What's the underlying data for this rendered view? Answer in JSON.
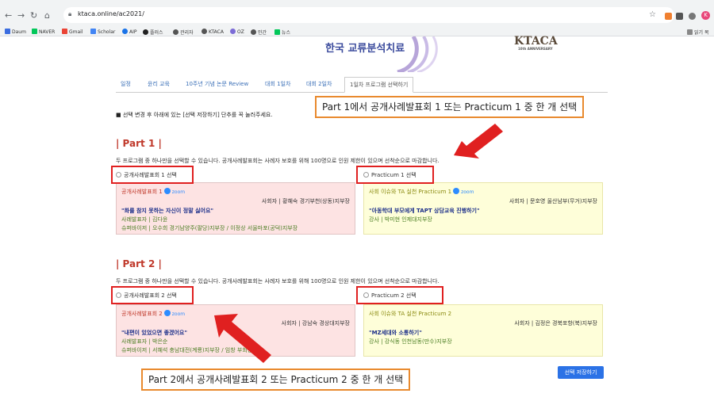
{
  "browser": {
    "url": "ktaca.online/ac2021/",
    "bookmarks": [
      "Daum",
      "NAVER",
      "Gmail",
      "Scholar",
      "AIP",
      "플러스",
      "관리자",
      "KTACA",
      "OZ",
      "민간",
      "뉴스"
    ],
    "reading_list": "읽기 목"
  },
  "banner": {
    "title": "한국 교류분석치료",
    "logo": "KTACA",
    "logo_sub": "10th ANNIVERSARY"
  },
  "tabs": [
    "일정",
    "윤리 교육",
    "10주년 기념 논문 Review",
    "대회 1일차",
    "대회 2일차",
    "1일차 프로그램 선택하기"
  ],
  "notice": "■ 선택 변경 후 아래에 있는 [선택 저장하기] 단추를 꼭 눌러주세요.",
  "part1": {
    "title": "| Part 1 |",
    "desc": "두 프로그램 중 하나만을 선택할 수 있습니다. 공개사례발표회는 사례자 보호를 위해 100명으로 인원 제한이 있으며 선착순으로 마감합니다.",
    "option_a": "공개사례발표회 1 선택",
    "option_b": "Practicum 1 선택",
    "a_title": "공개사례발표회 1",
    "a_moderator": "사회자 | 황혜숙 경기부천(상동)지부장",
    "a_topic": "\"화를 참지 못하는 자신이 정말 싫어요\"",
    "a_presenter": "사례발표자 | 김다윤",
    "a_supervisor": "슈퍼바이저 | 오수희 경기남양주(팔당)지부장 / 이정상 서울마포(공덕)지부장",
    "b_title": "사회 이슈와 TA 실천 Practicum 1",
    "b_moderator": "사회자 | 문호영 울산남부(무거)지부장",
    "b_topic": "\"아동학대 부모에게 TAPT 상담교육 진행하기\"",
    "b_lecturer": "강사 | 박미현 인제대지부장"
  },
  "part2": {
    "title": "| Part 2 |",
    "desc": "두 프로그램 중 하나만을 선택할 수 있습니다. 공개사례발표회는 사례자 보호를 위해 100명으로 인원 제한이 있으며 선착순으로 마감합니다.",
    "option_a": "공개사례발표회 2 선택",
    "option_b": "Practicum 2 선택",
    "a_title": "공개사례발표회 2",
    "a_moderator": "사회자 | 강남숙 경상대지부장",
    "a_topic": "\"내편이 있었으면 좋겠어요\"",
    "a_presenter": "사례발표자 | 박은순",
    "a_supervisor": "슈퍼바이저 | 서혜석 충남대전(계룡)지부장 / 임창 부회장",
    "b_title": "사회 이슈와 TA 실천 Practicum 2",
    "b_moderator": "사회자 | 김정은 경북포항(북)지부장",
    "b_topic": "\"MZ세대와 소통하기\"",
    "b_lecturer": "강사 | 강식동 인천남동(만수)지부장"
  },
  "zoom_label": "zoom",
  "callout1": "Part 1에서 공개사례발표회 1 또는 Practicum 1 중 한 개 선택",
  "callout2": "Part 2에서 공개사례발표회 2 또는 Practicum 2 중 한 개 선택",
  "save_button": "선택 저장하기",
  "colors": {
    "accent_red": "#c0392b",
    "callout_border": "#e98a2e",
    "highlight": "#e02020",
    "button": "#2b72e6"
  }
}
